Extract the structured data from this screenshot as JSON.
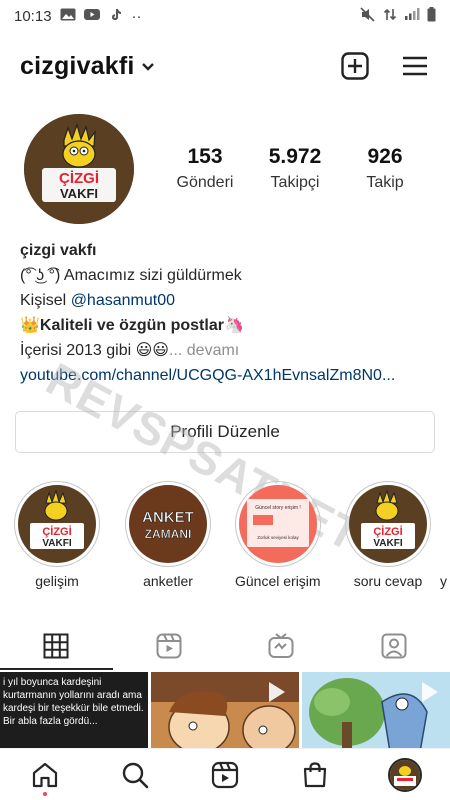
{
  "status_bar": {
    "time": "10:13",
    "extra": "··"
  },
  "header": {
    "username": "cizgivakfi"
  },
  "avatar": {
    "logo_top": "ÇİZGİ",
    "logo_bottom": "VAKFI"
  },
  "stats": [
    {
      "value": "153",
      "label": "Gönderi"
    },
    {
      "value": "5.972",
      "label": "Takipçi"
    },
    {
      "value": "926",
      "label": "Takip"
    }
  ],
  "bio": {
    "name": "çizgi vakfı",
    "line1": "(͡° ͜ʖ ͡°) Amacımız sizi güldürmek",
    "line2_prefix": "Kişisel ",
    "line2_mention": "@hasanmut00",
    "line3_emoji": "👑",
    "line3_text": "Kaliteli ve özgün postlar",
    "line3_emoji2": "🦄",
    "line4_text": "İçerisi 2013 gibi 😃😃",
    "line4_more": "... devamı",
    "link": "youtube.com/channel/UCGQG-AX1hEvnsalZm8N0..."
  },
  "edit_button": {
    "label": "Profili Düzenle"
  },
  "highlights": [
    {
      "label": "gelişim",
      "cover_top": "ÇİZGİ",
      "cover_bottom": "VAKFI"
    },
    {
      "label": "anketler",
      "cover_top": "ANKET",
      "cover_bottom": "ZAMANI"
    },
    {
      "label": "Güncel erişiml...",
      "cover_top": "Güncel story erişim !",
      "cover_bottom": "Zorluk seviyesi kolay"
    },
    {
      "label": "soru cevap",
      "cover_top": "ÇİZGİ",
      "cover_bottom": "VAKFI"
    },
    {
      "label": "y"
    }
  ],
  "grid": {
    "post1_text": "i yıl boyunca kardeşini kurtarmanın yollarını aradı ama kardeşi bir teşekkür bile etmedi. Bir abla fazla gördü..."
  },
  "watermark": "REVSPSATNET",
  "colors": {
    "accent_link": "#00376b",
    "notification_dot": "#ed4956",
    "border": "#dbdbdb"
  },
  "icons": {
    "header": [
      "new-post-icon",
      "menu-icon"
    ],
    "tabs": [
      "grid-icon",
      "reels-icon",
      "igtv-icon",
      "tagged-icon"
    ],
    "nav": [
      "home-icon",
      "search-icon",
      "reels-icon",
      "shop-icon",
      "profile-avatar"
    ]
  }
}
